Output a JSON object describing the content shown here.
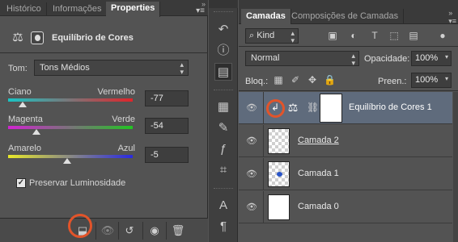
{
  "left_panel": {
    "tabs": [
      "Histórico",
      "Informações",
      "Properties"
    ],
    "collapse_icon": "double-chevron-right-icon",
    "menu_icon": "panel-menu-icon",
    "header": {
      "icon": "color-balance-icon",
      "mask_icon": "mask-icon",
      "title": "Equilíbrio de Cores"
    },
    "tom": {
      "label": "Tom:",
      "value": "Tons Médios"
    },
    "sliders": [
      {
        "left": "Ciano",
        "right": "Vermelho",
        "value": "-77",
        "level": -77,
        "gradient": [
          "#19c4c4",
          "#e0242a"
        ]
      },
      {
        "left": "Magenta",
        "right": "Verde",
        "value": "-54",
        "level": -54,
        "gradient": [
          "#d024d0",
          "#22c422"
        ]
      },
      {
        "left": "Amarelo",
        "right": "Azul",
        "value": "-5",
        "level": -5,
        "gradient": [
          "#e8e82a",
          "#2a2ae0"
        ]
      }
    ],
    "preserve": {
      "label": "Preservar Luminosidade",
      "checked": true
    },
    "bottom_icons": [
      "clip-to-layer-icon",
      "view-previous-state-icon",
      "reset-icon",
      "visibility-eye-icon",
      "trash-icon"
    ],
    "highlight_color": "#e2542a"
  },
  "mid_toolbar": {
    "icons": [
      "history-icon",
      "info-icon",
      "properties-icon",
      "swatches-icon",
      "brushes-icon",
      "styles-icon",
      "character-icon",
      "paragraph-icon",
      "glyphs-icon"
    ]
  },
  "right_panel": {
    "tabs": [
      "Camadas",
      "Composições de Camadas"
    ],
    "filter": {
      "kind": "Kind",
      "icons": [
        "pixel-filter-icon",
        "adjustment-filter-icon",
        "type-filter-icon",
        "shape-filter-icon",
        "smart-object-filter-icon"
      ]
    },
    "blend_mode": "Normal",
    "opacity": {
      "label": "Opacidade:",
      "value": "100%"
    },
    "lock": {
      "label": "Bloq.:",
      "icons": [
        "lock-transparent-icon",
        "lock-image-icon",
        "lock-position-icon",
        "lock-all-icon"
      ]
    },
    "fill": {
      "label": "Preen.:",
      "value": "100%"
    },
    "layers": [
      {
        "name": "Equilíbrio de Cores 1",
        "type": "adjustment",
        "selected": true
      },
      {
        "name": "Camada 2",
        "type": "transparent",
        "underline": true
      },
      {
        "name": "Camada 1",
        "type": "transparent-blue"
      },
      {
        "name": "Camada 0",
        "type": "white"
      }
    ]
  }
}
